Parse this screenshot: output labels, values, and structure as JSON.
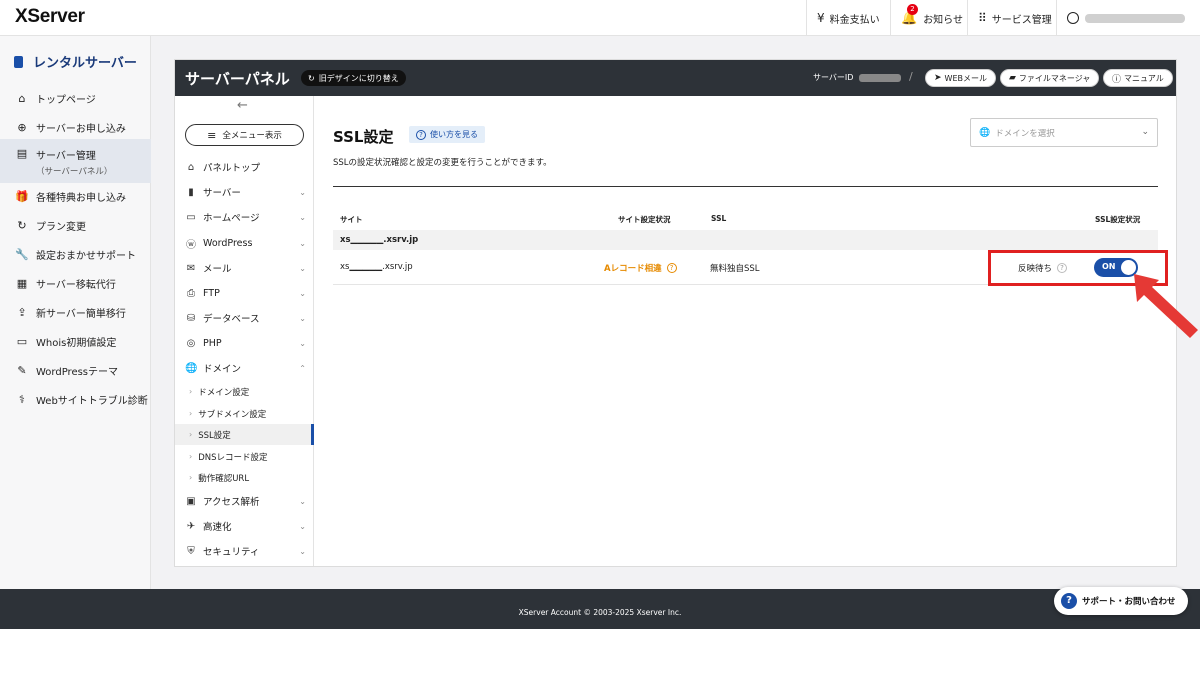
{
  "header": {
    "logo": "XServer",
    "billing": "料金支払い",
    "notifications": "お知らせ",
    "notification_count": "2",
    "service_mgmt": "サービス管理"
  },
  "sidebar": {
    "title": "レンタルサーバー",
    "items": [
      {
        "label": "トップページ",
        "icon": "home-icon"
      },
      {
        "label": "サーバーお申し込み",
        "icon": "plus-circle-icon"
      },
      {
        "label": "サーバー管理",
        "sub": "（サーバーパネル）",
        "icon": "server-icon"
      },
      {
        "label": "各種特典お申し込み",
        "icon": "gift-icon"
      },
      {
        "label": "プラン変更",
        "icon": "refresh-icon"
      },
      {
        "label": "設定おまかせサポート",
        "icon": "wrench-icon"
      },
      {
        "label": "サーバー移転代行",
        "icon": "truck-icon"
      },
      {
        "label": "新サーバー簡単移行",
        "icon": "migrate-icon"
      },
      {
        "label": "Whois初期値設定",
        "icon": "document-icon"
      },
      {
        "label": "WordPressテーマ",
        "icon": "edit-icon"
      },
      {
        "label": "Webサイトトラブル診断",
        "icon": "stethoscope-icon"
      }
    ]
  },
  "panel": {
    "title": "サーバーパネル",
    "old_design": "旧デザインに切り替え",
    "server_id_label": "サーバーID",
    "webmail": "WEBメール",
    "file_manager": "ファイルマネージャ",
    "manual": "マニュアル"
  },
  "innernav": {
    "all_menu": "全メニュー表示",
    "items": [
      "パネルトップ",
      "サーバー",
      "ホームページ",
      "WordPress",
      "メール",
      "FTP",
      "データベース",
      "PHP",
      "ドメイン"
    ],
    "domain_subs": [
      "ドメイン設定",
      "サブドメイン設定",
      "SSL設定",
      "DNSレコード設定",
      "動作確認URL"
    ],
    "items_after": [
      "アクセス解析",
      "高速化",
      "セキュリティ"
    ]
  },
  "content": {
    "title": "SSL設定",
    "help": "使い方を見る",
    "description": "SSLの設定状況確認と設定の変更を行うことができます。",
    "domain_placeholder": "ドメインを選択",
    "columns": {
      "site": "サイト",
      "site_status": "サイト設定状況",
      "ssl": "SSL",
      "ssl_status": "SSL設定状況"
    },
    "group": "xs▁▁▁▁▁.xsrv.jp",
    "row": {
      "site": "xs▁▁▁▁▁.xsrv.jp",
      "site_status": "Aレコード相違",
      "ssl": "無料独自SSL",
      "reflect": "反映待ち",
      "toggle": "ON"
    }
  },
  "footer": {
    "copyright": "XServer Account © 2003-2025 Xserver Inc.",
    "support": "サポート・お問い合わせ"
  },
  "colors": {
    "accent": "#1a4fa8",
    "dark": "#2d3238",
    "highlight": "#e02020",
    "warning": "#e68a00"
  }
}
